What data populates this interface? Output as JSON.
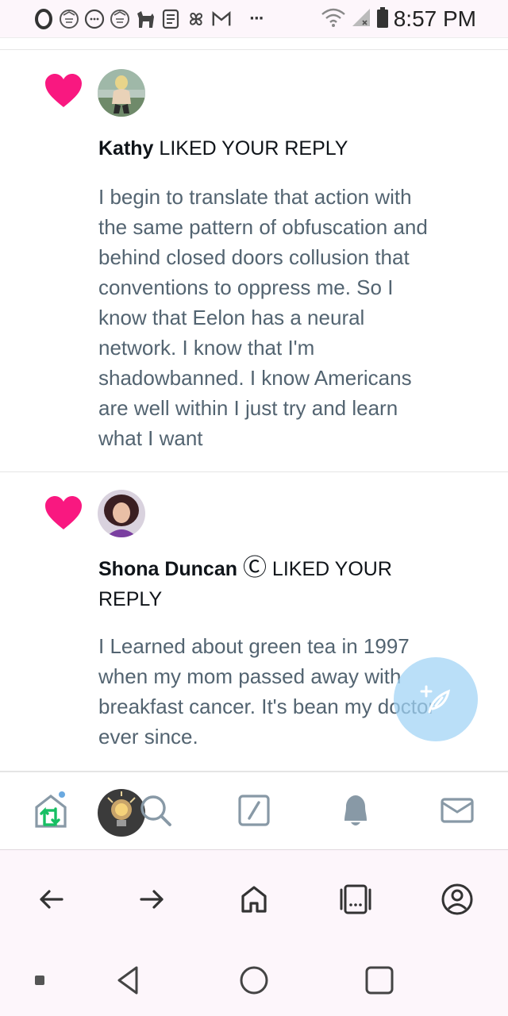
{
  "status_bar": {
    "time": "8:57 PM",
    "icons": [
      "opera-icon",
      "badge-icon",
      "messenger-icon",
      "badge-icon",
      "animal-icon",
      "notebook-icon",
      "pinwheel-icon",
      "gmail-icon",
      "more-dots-icon",
      "wifi-icon",
      "signal-icon",
      "battery-icon"
    ],
    "more_dots": "···"
  },
  "notifications": [
    {
      "user": "Kathy",
      "action": "LIKED YOUR REPLY",
      "text": "I begin to translate that action with the same pattern of obfuscation and behind closed doors collusion that conventions to oppress me. So I know that Eelon has a neural network. I know that I'm shadowbanned. I know Americans are well within I just try and learn what I want",
      "lines": [
        "I begin to translate that action with",
        "the same pattern of obfuscation and",
        "behind closed doors collusion that",
        "conventions to oppress me. So I",
        "know that Eelon has a neural",
        "network. I know that I'm",
        "shadowbanned. I know Americans",
        "are well within I just try and learn",
        "what I want"
      ]
    },
    {
      "user": "Shona Duncan",
      "user_badge": "Ⓒ",
      "action": "LIKED YOUR",
      "action_line2": "REPLY",
      "lines": [
        "I Learned about green tea in 1997",
        "when my mom passed away with",
        "breakfast cancer. It's bean my doctor",
        "ever since."
      ]
    }
  ],
  "colors": {
    "heart": "#f91880",
    "fab": "#a0d2f5",
    "nav_icon": "#8899a6",
    "accent_green": "#17bf63"
  },
  "twitter_nav": [
    "home-icon",
    "profile-avatar",
    "search-icon",
    "compose-icon",
    "bell-icon",
    "mail-icon"
  ],
  "browser_bar": [
    "back-arrow-icon",
    "forward-arrow-icon",
    "home-icon",
    "tabs-icon",
    "account-icon"
  ],
  "android_nav": [
    "recent-square-small",
    "back-triangle-icon",
    "home-circle-icon",
    "overview-square-icon"
  ]
}
